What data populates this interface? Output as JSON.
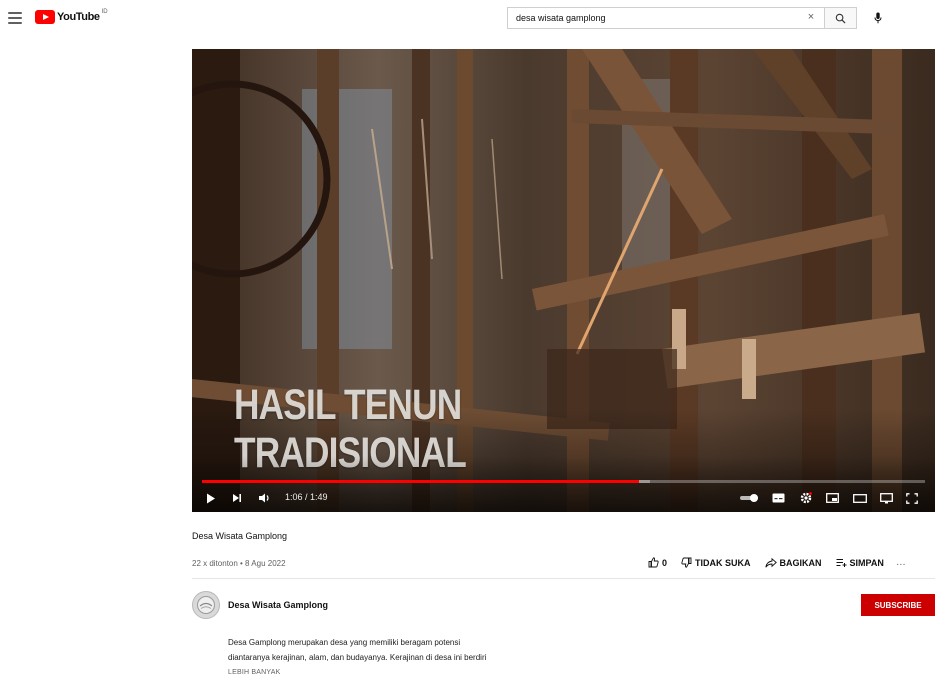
{
  "header": {
    "logo_text": "YouTube",
    "region": "ID",
    "search": {
      "value": "desa wisata gamplong",
      "clear_glyph": "×"
    },
    "icons": [
      "menu-icon",
      "youtube-logo-icon",
      "search-icon",
      "mic-icon"
    ]
  },
  "player": {
    "overlay_line1": "HASIL TENUN",
    "overlay_line2": "TRADISIONAL",
    "time": "1:06 / 1:49",
    "progress_fraction": 0.605,
    "loaded_fraction": 0.62,
    "icons": [
      "play-icon",
      "next-icon",
      "volume-icon",
      "autoplay-toggle-icon",
      "subtitles-icon",
      "settings-icon",
      "miniplayer-icon",
      "theater-icon",
      "cast-icon",
      "fullscreen-icon"
    ]
  },
  "video": {
    "title": "Desa Wisata Gamplong",
    "meta": "22 x ditonton • 8 Agu 2022",
    "actions": {
      "like_count": "0",
      "dislike_label": "TIDAK SUKA",
      "share_label": "BAGIKAN",
      "save_label": "SIMPAN",
      "more_glyph": "…"
    }
  },
  "channel": {
    "name": "Desa Wisata Gamplong",
    "subscribe_label": "SUBSCRIBE"
  },
  "description": {
    "line1": "Desa Gamplong merupakan desa yang memiliki beragam potensi",
    "line2": "diantaranya kerajinan, alam, dan budayanya. Kerajinan di desa ini  berdiri",
    "show_more": "LEBIH BANYAK"
  },
  "colors": {
    "brand_red": "#ff0000",
    "subscribe_red": "#cc0000",
    "text_secondary": "#606060"
  }
}
